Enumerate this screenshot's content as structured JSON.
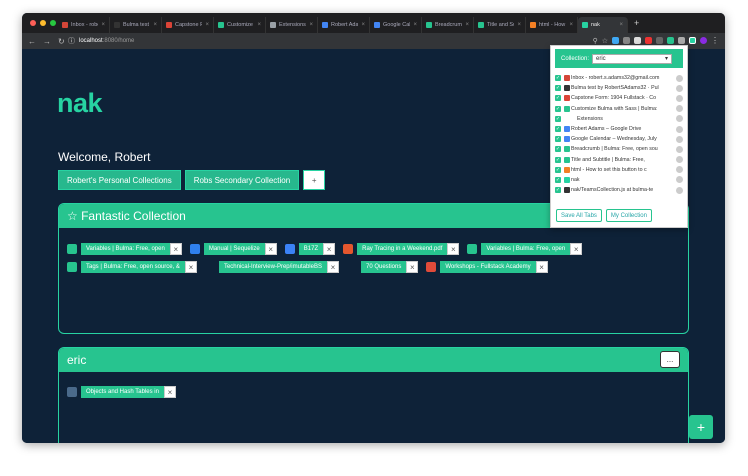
{
  "browser": {
    "tabs": [
      {
        "label": "Inbox - robe",
        "color": "#d44638"
      },
      {
        "label": "Bulma test b",
        "color": "#333333"
      },
      {
        "label": "Capstone Fo",
        "color": "#db4437"
      },
      {
        "label": "Customize B",
        "color": "#27c48f"
      },
      {
        "label": "Extensions",
        "color": "#9aa0a6"
      },
      {
        "label": "Robert Adam",
        "color": "#4285f4"
      },
      {
        "label": "Google Cale",
        "color": "#4285f4"
      },
      {
        "label": "Breadcrumb",
        "color": "#27c48f"
      },
      {
        "label": "Title and Su",
        "color": "#27c48f"
      },
      {
        "label": "html - How",
        "color": "#f48024"
      },
      {
        "label": "nak",
        "color": "#27d3a2"
      }
    ],
    "new_tab": "+",
    "url_host": "localhost",
    "url_rest": ":8080/home"
  },
  "page": {
    "logo": "nak",
    "welcome": "Welcome, Robert",
    "collection_tabs": [
      "Robert's Personal Collections",
      "Robs Secondary Collection"
    ],
    "add_tab": "+",
    "fab": "+"
  },
  "cards": {
    "fantastic": {
      "title": "☆ Fantastic Collection",
      "chips": [
        {
          "label": "Variables | Bulma: Free, open",
          "icon": "bulma-icon",
          "color": "#27c48f"
        },
        {
          "label": "Manual | Sequelize",
          "icon": "sequelize-icon",
          "color": "#2f80ed"
        },
        {
          "label": "B17Z",
          "icon": "bolt-icon",
          "color": "#3b82f6"
        },
        {
          "label": "Ray Tracing in a Weekend.pdf",
          "icon": "pdf-icon",
          "color": "#e4572e"
        },
        {
          "label": "Variables | Bulma: Free, open",
          "icon": "bulma-icon",
          "color": "#27c48f"
        },
        {
          "label": "Tags | Bulma: Free, open source, &",
          "icon": "bulma-icon",
          "color": "#27c48f"
        },
        {
          "label": "Technical-Interview-Prep/imutableBS",
          "icon": "github-icon",
          "color": "#0e2238"
        },
        {
          "label": "70 Questions",
          "icon": "doc-icon",
          "color": "#0e2238"
        },
        {
          "label": "Workshops - Fullstack Academy",
          "icon": "fullstack-icon",
          "color": "#e04b3a"
        }
      ]
    },
    "eric": {
      "title": "eric",
      "menu": "...",
      "chips": [
        {
          "label": "Objects and Hash Tables in",
          "icon": "site-icon",
          "color": "#4a6a8a"
        }
      ]
    }
  },
  "popup": {
    "label": "Collection:",
    "selected": "eric",
    "items": [
      {
        "text": "Inbox - robert.s.adams32@gmail.com",
        "color": "#d44638"
      },
      {
        "text": "Bulma test by RobertSAdams32 · Pul",
        "color": "#333333"
      },
      {
        "text": "Capstone Form: 1904 Fullstack · Co",
        "color": "#db4437"
      },
      {
        "text": "Customize Bulma with Sass | Bulma:",
        "color": "#27c48f"
      },
      {
        "text": "Extensions",
        "color": "#ffffff",
        "indent": true
      },
      {
        "text": "Robert Adams – Google Drive",
        "color": "#4285f4"
      },
      {
        "text": "Google Calendar – Wednesday, July",
        "color": "#4285f4"
      },
      {
        "text": "Breadcrumb | Bulma: Free, open sou",
        "color": "#27c48f"
      },
      {
        "text": "Title and Subtitle | Bulma: Free,",
        "color": "#27c48f"
      },
      {
        "text": "html - How to set this button to c",
        "color": "#f48024"
      },
      {
        "text": "nak",
        "color": "#27d3a2"
      },
      {
        "text": "nak/TeamsCollection.js at bulma-te",
        "color": "#333333"
      }
    ],
    "save_all": "Save All Tabs",
    "my_collection": "My Collection"
  },
  "colors": {
    "accent": "#27c48f",
    "background": "#0e2238"
  }
}
